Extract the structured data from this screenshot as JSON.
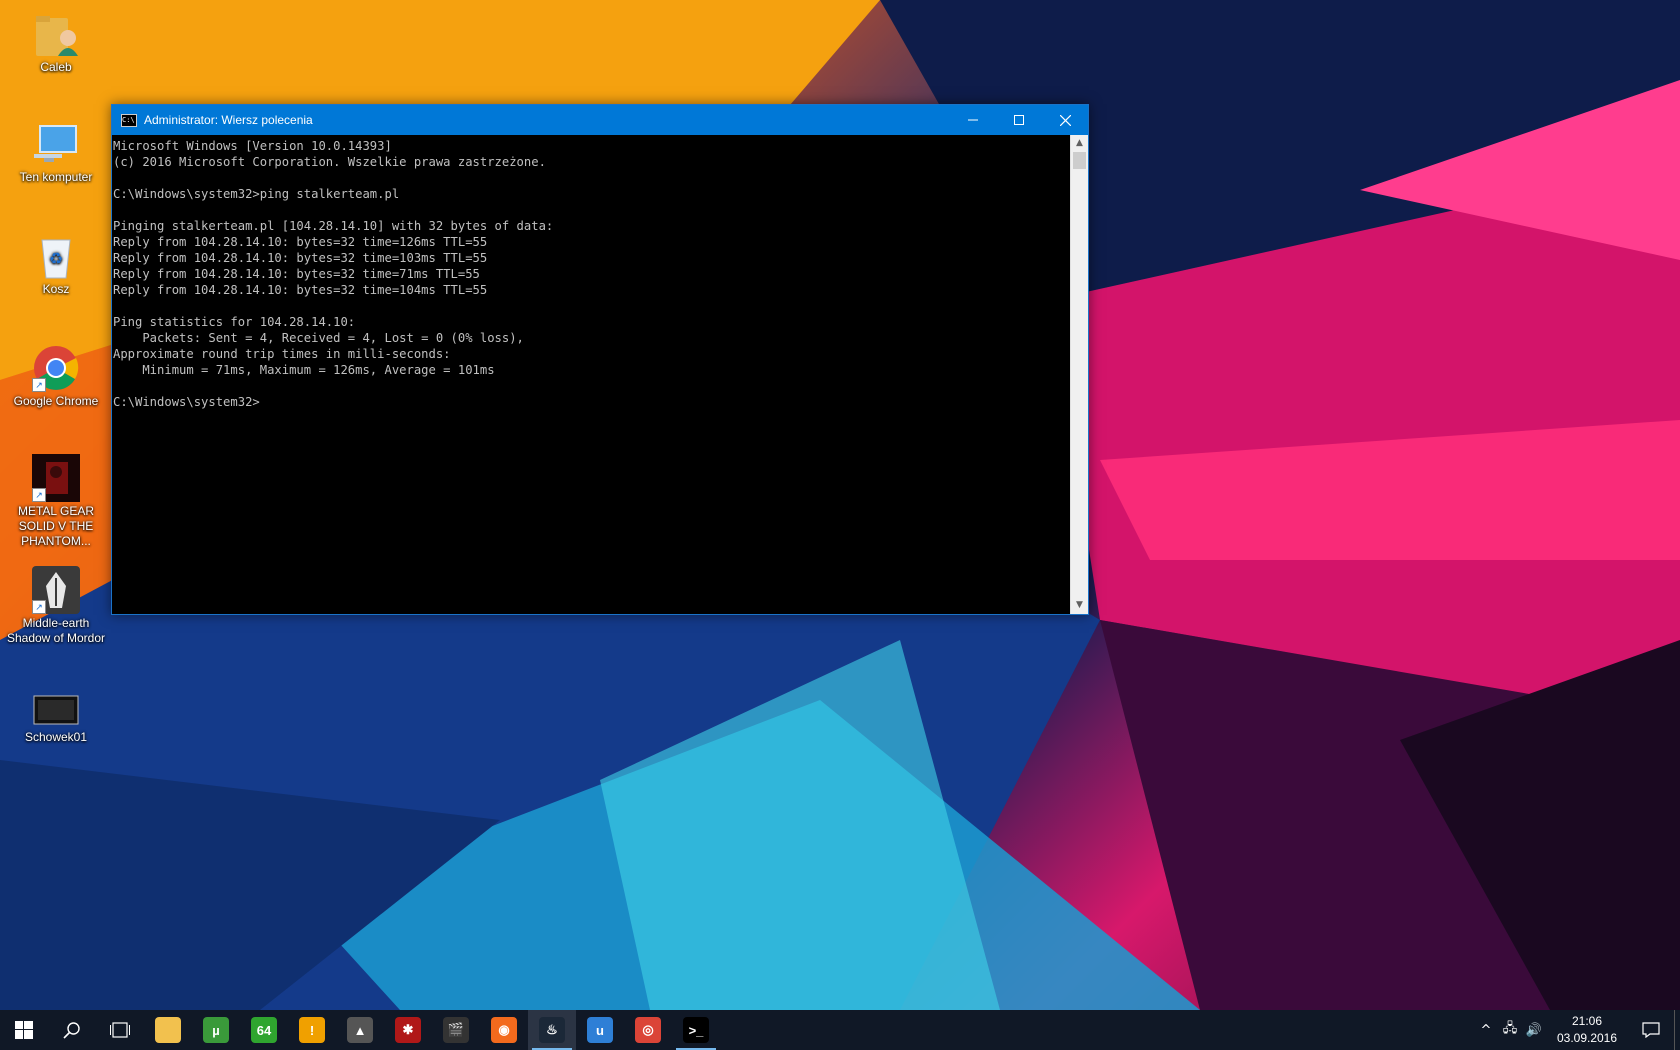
{
  "desktop": {
    "icons": [
      {
        "label": "Caleb",
        "icon": "user-folder-icon"
      },
      {
        "label": "Ten komputer",
        "icon": "computer-icon"
      },
      {
        "label": "Kosz",
        "icon": "recycle-bin-icon"
      },
      {
        "label": "Google Chrome",
        "icon": "chrome-icon"
      },
      {
        "label": "METAL GEAR SOLID V THE PHANTOM...",
        "icon": "mgsv-game-icon"
      },
      {
        "label": "Middle-earth Shadow of Mordor",
        "icon": "shadow-of-mordor-icon"
      },
      {
        "label": "Schowek01",
        "icon": "screenshot-file-icon"
      }
    ]
  },
  "window": {
    "title": "Administrator: Wiersz polecenia",
    "icon": "cmd-icon",
    "minimize_glyph": "—",
    "maximize_glyph": "☐",
    "close_glyph": "✕",
    "console_lines": [
      "Microsoft Windows [Version 10.0.14393]",
      "(c) 2016 Microsoft Corporation. Wszelkie prawa zastrzeżone.",
      "",
      "C:\\Windows\\system32>ping stalkerteam.pl",
      "",
      "Pinging stalkerteam.pl [104.28.14.10] with 32 bytes of data:",
      "Reply from 104.28.14.10: bytes=32 time=126ms TTL=55",
      "Reply from 104.28.14.10: bytes=32 time=103ms TTL=55",
      "Reply from 104.28.14.10: bytes=32 time=71ms TTL=55",
      "Reply from 104.28.14.10: bytes=32 time=104ms TTL=55",
      "",
      "Ping statistics for 104.28.14.10:",
      "    Packets: Sent = 4, Received = 4, Lost = 0 (0% loss),",
      "Approximate round trip times in milli-seconds:",
      "    Minimum = 71ms, Maximum = 126ms, Average = 101ms",
      "",
      "C:\\Windows\\system32>"
    ],
    "colors": {
      "titlebar": "#0078d7",
      "console_bg": "#000000",
      "console_fg": "#c0c0c0"
    }
  },
  "taskbar": {
    "start_icon": "windows-start-icon",
    "search_icon": "search-icon",
    "task_view_icon": "task-view-icon",
    "apps": [
      {
        "name": "file-explorer",
        "icon": "folder-icon",
        "glyph": "",
        "color": "#f2c14e",
        "running": false
      },
      {
        "name": "utorrent",
        "icon": "utorrent-icon",
        "glyph": "µ",
        "color": "#3a9a3a",
        "running": false
      },
      {
        "name": "n64-emulator",
        "icon": "n64-icon",
        "glyph": "64",
        "color": "#2fa52f",
        "running": false
      },
      {
        "name": "avast",
        "icon": "warning-triangle-icon",
        "glyph": "!",
        "color": "#f0a000",
        "running": false
      },
      {
        "name": "aimp",
        "icon": "aimp-icon",
        "glyph": "▲",
        "color": "#555555",
        "running": false
      },
      {
        "name": "game-app",
        "icon": "creature-icon",
        "glyph": "✱",
        "color": "#b01818",
        "running": false
      },
      {
        "name": "video-editor",
        "icon": "clapperboard-icon",
        "glyph": "🎬",
        "color": "#333333",
        "running": false
      },
      {
        "name": "origin",
        "icon": "origin-icon",
        "glyph": "◉",
        "color": "#f36a1d",
        "running": false
      },
      {
        "name": "steam",
        "icon": "steam-icon",
        "glyph": "♨",
        "color": "#1b2838",
        "running": true
      },
      {
        "name": "uplay",
        "icon": "uplay-icon",
        "glyph": "u",
        "color": "#2e7fd6",
        "running": false
      },
      {
        "name": "google-chrome",
        "icon": "chrome-icon",
        "glyph": "◎",
        "color": "#db4437",
        "running": false
      },
      {
        "name": "command-prompt",
        "icon": "cmd-icon",
        "glyph": ">_",
        "color": "#000000",
        "running": true
      }
    ],
    "tray": {
      "chevron_glyph": "^",
      "network_glyph": "🖧",
      "volume_glyph": "🔊",
      "time": "21:06",
      "date": "03.09.2016"
    }
  }
}
